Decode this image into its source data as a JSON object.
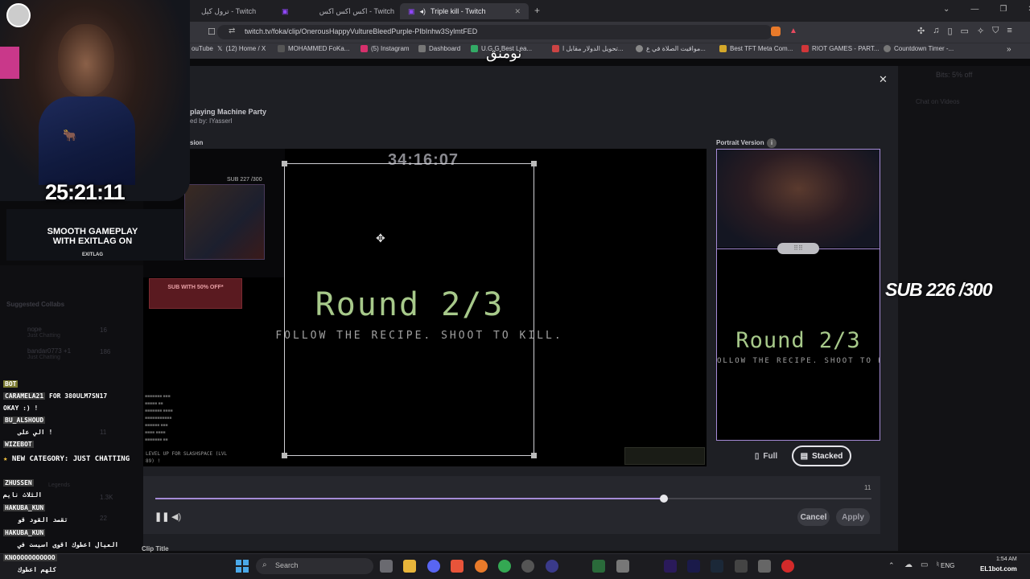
{
  "browser": {
    "tabs": [
      {
        "label": "ترول كيل - Twitch",
        "active": false
      },
      {
        "label": "اكس اكس اكس - Twitch",
        "active": false
      },
      {
        "label": "Triple kill - Twitch",
        "active": true
      }
    ],
    "url": "twitch.tv/foka/clip/OnerousHappyVultureBleedPurple-PIbInhw3SylmtFED",
    "bookmarks": [
      {
        "label": "ouTube"
      },
      {
        "label": "(12) Home / X"
      },
      {
        "label": "MOHAMMED FoKa..."
      },
      {
        "label": "(5) Instagram"
      },
      {
        "label": "Dashboard"
      },
      {
        "label": "U.G.G Best Lea..."
      },
      {
        "label": "تحويل الدولار مقابل ا..."
      },
      {
        "label": "مواقيت الصلاة في ع..."
      },
      {
        "label": "Best TFT Meta Com..."
      },
      {
        "label": "RIOT GAMES - PART..."
      },
      {
        "label": "Countdown Timer -..."
      }
    ]
  },
  "overlay": {
    "top_text": "نومنق",
    "timer": "25:21:11",
    "sub_counter": "SUB 226 /300",
    "ad_line1": "SMOOTH GAMEPLAY",
    "ad_line2": "WITH EXITLAG ON",
    "ad_brand": "EXITLAG",
    "sub_promo": "SUB WITH 50% OFF*"
  },
  "clip_editor": {
    "title_partial": "playing Machine Party",
    "clipped_by": "ed by: IYasserI",
    "section_label": "sion",
    "portrait_label": "Portrait Version",
    "video_timer": "34:16:07",
    "inner_sub_counter": "SUB 227 /300",
    "round_text": "Round 2/3",
    "round_subtitle": "FOLLOW THE RECIPE. SHOOT TO KILL.",
    "portrait_round_text": "Round 2/3",
    "portrait_subtitle": "OLLOW THE RECIPE. SHOOT TO K",
    "full_label": "Full",
    "stacked_label": "Stacked",
    "timeline_count": "11",
    "timeline_progress": 0.71,
    "cancel_label": "Cancel",
    "apply_label": "Apply",
    "clip_title_label": "Clip Title",
    "levelup_text": "LEVEL UP FOR SLASHSPACE (LVL 89) !"
  },
  "background_page": {
    "sub_text": "Bits: 5% off",
    "chat_on_videos": "Chat on Videos",
    "suggested_label": "Suggested Collabs",
    "followers": [
      {
        "name": "nope",
        "sub": "Just Chatting",
        "count": "16"
      },
      {
        "name": "bandar0773 +1",
        "sub": "Just Chatting",
        "count": "186"
      },
      {
        "name": "",
        "sub": "",
        "count": "11"
      },
      {
        "name": "",
        "sub": "Legends",
        "count": "1.3K"
      },
      {
        "name": "",
        "sub": "",
        "count": "22"
      }
    ]
  },
  "chat": [
    {
      "user": "BOT",
      "text": ""
    },
    {
      "user": "CARAMELA21",
      "text": "FOR 380ULM7SN17"
    },
    {
      "user": "",
      "text": "OKAY :) !"
    },
    {
      "user": "BU_ALSHOUD",
      "text": ""
    },
    {
      "user": "",
      "text": "الي على !"
    },
    {
      "user": "WIZEBOT",
      "text": ""
    },
    {
      "user": "",
      "text": "NEW CATEGORY: JUST CHATTING"
    },
    {
      "user": "ZHUSSEN",
      "text": ""
    },
    {
      "user": "",
      "text": "الثلاث نايم"
    },
    {
      "user": "HAKUBA_KUN",
      "text": ""
    },
    {
      "user": "",
      "text": "تقصد القود قو"
    },
    {
      "user": "HAKUBA_KUN",
      "text": ""
    },
    {
      "user": "",
      "text": "العيال اعطوك اقوى اسيست في"
    },
    {
      "user": "KNOOOOOOOOOOO",
      "text": ""
    },
    {
      "user": "",
      "text": "كلهم اعطوك"
    }
  ],
  "taskbar": {
    "search_placeholder": "Search",
    "lang": "ENG",
    "time": "1:54 AM",
    "watermark": "EL1bot.com"
  },
  "colors": {
    "accent": "#a58bd6",
    "round_text": "#a7c98a",
    "modal_bg": "#1e1f24"
  }
}
